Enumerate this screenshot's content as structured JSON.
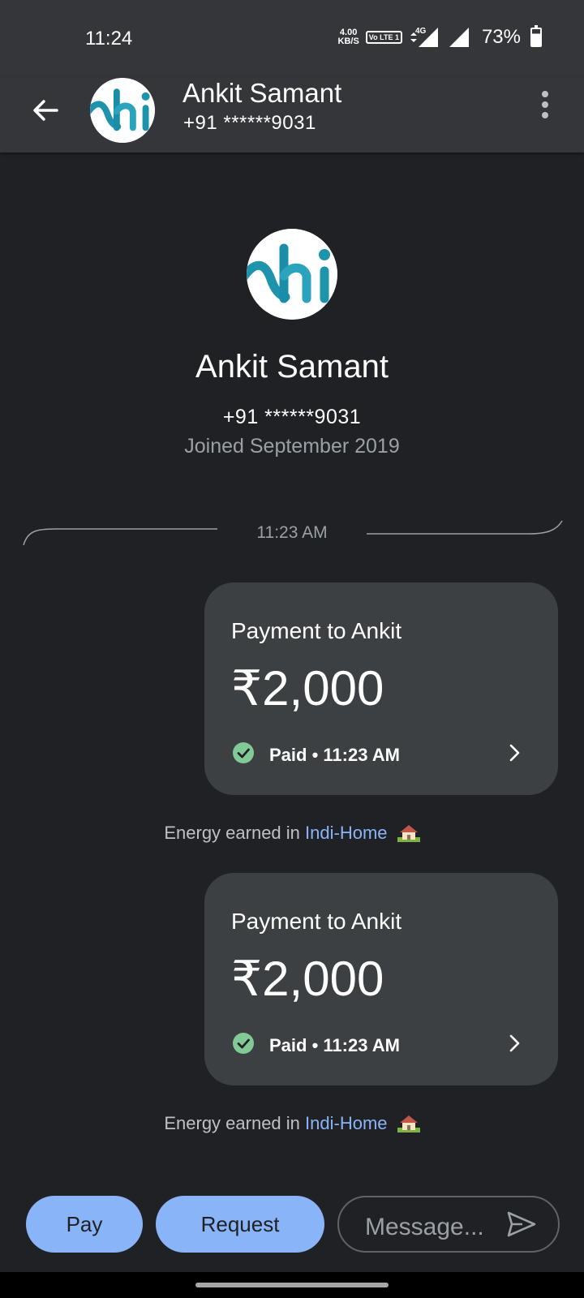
{
  "status_bar": {
    "time": "11:24",
    "speed_value": "4.00",
    "speed_unit": "KB/S",
    "volte": "Vo LTE 1",
    "network": "4G",
    "battery": "73%",
    "battery_level": 0.73
  },
  "header": {
    "contact_name": "Ankit Samant",
    "contact_phone": "+91 ******9031"
  },
  "profile": {
    "name": "Ankit Samant",
    "phone": "+91 ******9031",
    "joined": "Joined September 2019"
  },
  "conversation": {
    "divider_time": "11:23 AM",
    "payments": [
      {
        "title": "Payment to Ankit",
        "amount": "₹2,000",
        "status": "Paid • 11:23 AM",
        "reward_prefix": "Energy earned in",
        "reward_link": "Indi-Home"
      },
      {
        "title": "Payment to Ankit",
        "amount": "₹2,000",
        "status": "Paid • 11:23 AM",
        "reward_prefix": "Energy earned in",
        "reward_link": "Indi-Home"
      }
    ]
  },
  "composer": {
    "pay_label": "Pay",
    "request_label": "Request",
    "message_placeholder": "Message..."
  },
  "colors": {
    "background": "#202124",
    "app_bar": "#35363a",
    "card": "#3c4043",
    "accent": "#8ab4f8",
    "paid_green": "#81c995"
  }
}
